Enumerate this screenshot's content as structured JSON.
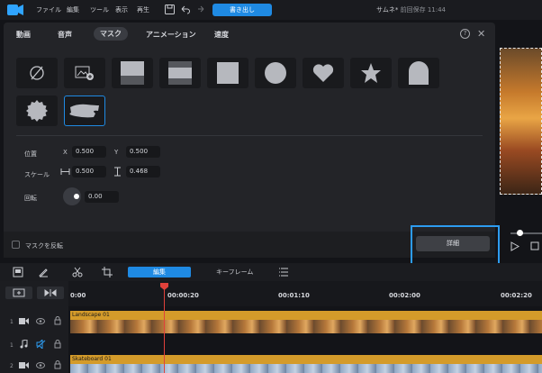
{
  "titlebar": {
    "menu": [
      "ファイル",
      "編集",
      "ツール",
      "表示",
      "再生"
    ],
    "export_label": "書き出し",
    "title": "サムネ*",
    "saved_time": "前回保存 11:44"
  },
  "panel": {
    "tabs": [
      "動画",
      "音声",
      "マスク",
      "アニメーション",
      "速度"
    ],
    "active_tab": "マスク",
    "mask_shapes": [
      "none",
      "image",
      "rect-top",
      "rect-middle",
      "square",
      "circle",
      "heart",
      "star",
      "arch",
      "seal",
      "brush-stroke"
    ],
    "selected_shape": "brush-stroke",
    "position_label": "位置",
    "position_x_label": "X",
    "position_x": "0.500",
    "position_y_label": "Y",
    "position_y": "0.500",
    "scale_label": "スケール",
    "scale_w": "0.500",
    "scale_h": "0.468",
    "rotation_label": "回転",
    "rotation_value": "0.00",
    "invert_label": "マスクを反転",
    "detail_label": "詳細"
  },
  "timeline": {
    "edit_tab": "編集",
    "keyframe_tab": "キーフレーム",
    "ticks": [
      "0:00",
      "00:00:20",
      "00:01:10",
      "00:02:00",
      "00:02:20"
    ],
    "tracks": [
      "1",
      "1",
      "2"
    ],
    "clips": {
      "clip1": "Landscape 01",
      "clip2": "Skateboard 01"
    },
    "colors": {
      "accent": "#1f8ae3",
      "playhead": "#e0413b",
      "clip": "#d49b2a"
    }
  }
}
